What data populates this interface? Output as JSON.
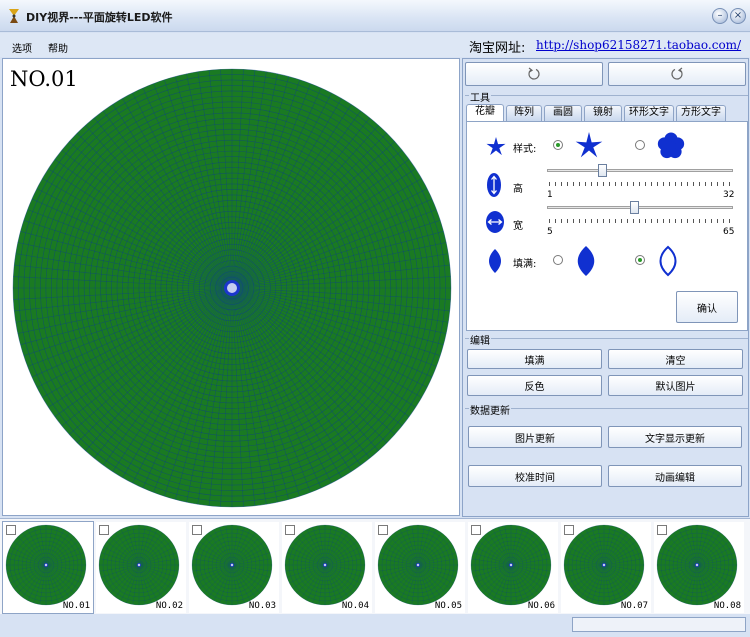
{
  "window": {
    "title": "DIY视界---平面旋转LED软件",
    "minimize_glyph": "–",
    "close_glyph": "×"
  },
  "menu": [
    "选项",
    "帮助"
  ],
  "shop": {
    "label": "淘宝网址:",
    "url": "http://shop62158271.taobao.com/"
  },
  "canvas": {
    "frame_label": "NO.01",
    "disc_color": "#1a7a22",
    "grid_color": "#0b3d8f",
    "center_color": "#1f2fe0"
  },
  "rotate": {
    "ccw_icon": "rotate-ccw-icon",
    "cw_icon": "rotate-cw-icon"
  },
  "tools": {
    "group_label": "工具",
    "tabs": [
      "花瓣",
      "阵列",
      "画圆",
      "镜射",
      "环形文字",
      "方形文字"
    ],
    "active_tab": 0,
    "style_label": "样式:",
    "height_label": "高",
    "height_min": "1",
    "height_max": "32",
    "height_value_fraction": 0.29,
    "width_label": "宽",
    "width_min": "5",
    "width_max": "65",
    "width_value_fraction": 0.46,
    "fill_label": "填满:",
    "style_selected": "star",
    "fill_selected": "outline",
    "confirm_label": "确认",
    "icon_color": "#1030d0"
  },
  "edit": {
    "group_label": "编辑",
    "fill_button": "填满",
    "clear_button": "清空",
    "invert_button": "反色",
    "default_image_button": "默认图片"
  },
  "update": {
    "group_label": "数据更新",
    "image_update_button": "图片更新",
    "text_update_button": "文字显示更新",
    "calibrate_time_button": "校准时间",
    "animation_edit_button": "动画编辑"
  },
  "frames": [
    "NO.01",
    "NO.02",
    "NO.03",
    "NO.04",
    "NO.05",
    "NO.06",
    "NO.07",
    "NO.08"
  ]
}
